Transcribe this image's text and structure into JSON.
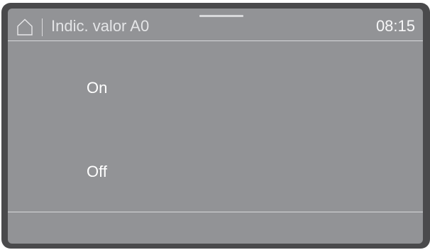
{
  "header": {
    "title": "Indic. valor A0",
    "time": "08:15",
    "home_icon": "home-icon"
  },
  "options": [
    {
      "label": "On"
    },
    {
      "label": "Off"
    }
  ]
}
